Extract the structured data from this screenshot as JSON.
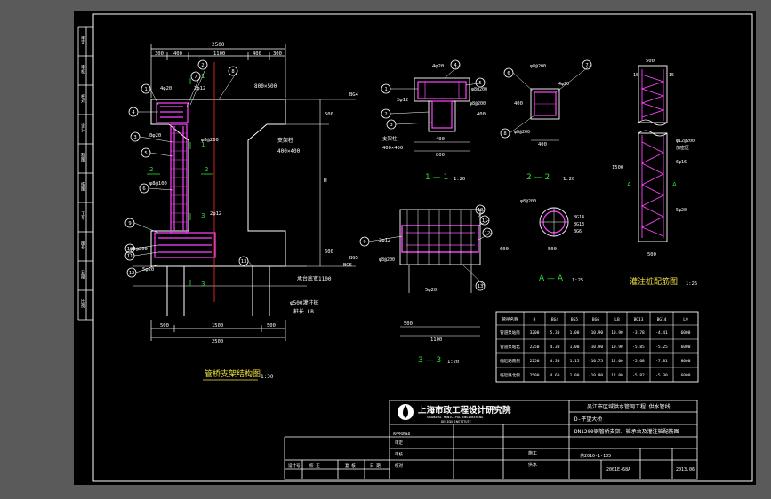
{
  "side_strip": [
    "审定",
    "审核",
    "校对",
    "设计",
    "制图",
    "描图",
    "工号",
    "图号",
    "日期",
    "比例"
  ],
  "main_view": {
    "title": "管桥支架结构图",
    "scale": "1:30",
    "dims_top": [
      "2500",
      "300",
      "400",
      "1100",
      "400",
      "300"
    ],
    "dims_bottom": [
      "500",
      "1500",
      "500",
      "2500"
    ],
    "beam_label": "800×500",
    "pier_label": "支架柱",
    "pier_size": "400×400",
    "pile_label": "承台底宽1100",
    "pile_note_1": "φ500灌注桩",
    "pile_note_2": "桩长 LB",
    "elev_bg4": "BG4",
    "elev_bg5": "BG5",
    "elev_bg6": "BG6",
    "h_label": "H",
    "dim_500": "500",
    "dim_600": "600",
    "rebar_4d20": "4φ20",
    "rebar_2d12": "2φ12",
    "rebar_8d20": "8φ20",
    "rebar_5d20": "5φ20",
    "rebar_s8": "φ8@200",
    "rebar_s8b": "φ8@200",
    "rebar_s8c": "φ8@100",
    "rebar_2d12b": "2φ12",
    "rebar_8d20b": "8φ20",
    "section_marks": [
      "1",
      "1",
      "2",
      "2",
      "3",
      "3"
    ],
    "balloons": [
      "1",
      "2",
      "3",
      "4",
      "5",
      "6",
      "7",
      "8",
      "9",
      "10",
      "11",
      "12",
      "13"
    ]
  },
  "section_1": {
    "title": "1 — 1",
    "scale": "1:20",
    "rebar_top": "4φ20",
    "rebar_side": "2φ12",
    "rebar_stir": "φ8@200",
    "rebar_stir2": "φ8@200",
    "label_pier": "支架柱",
    "pier_size": "400×400",
    "dims": [
      "400",
      "800",
      "400"
    ],
    "balloons": [
      "1",
      "2",
      "3",
      "4",
      "5"
    ]
  },
  "section_2": {
    "title": "2 — 2",
    "scale": "1:20",
    "rebar": [
      "φ8@200",
      "4φ20",
      "φ8@200"
    ],
    "dims": [
      "400",
      "400"
    ],
    "balloons": [
      "6",
      "7",
      "8"
    ]
  },
  "section_3": {
    "title": "3 — 3",
    "scale": "1:20",
    "rebar": [
      "2φ12",
      "φ8@200",
      "5φ20"
    ],
    "dims": [
      "500",
      "1100",
      "600"
    ],
    "balloons": [
      "9",
      "10",
      "11",
      "12",
      "13"
    ]
  },
  "section_a": {
    "title": "A — A",
    "scale": "1:25",
    "rebar": "φ8@200",
    "labels": [
      "BG14",
      "BG13",
      "BG6"
    ],
    "dims": [
      "500"
    ]
  },
  "pile_view": {
    "title": "灌注桩配筋图",
    "scale": "1:25",
    "dims": [
      "500",
      "15",
      "15",
      "1500",
      "500"
    ],
    "label_a": "A",
    "rebar": [
      "φ12@200",
      "加密区",
      "6φ16",
      "5φ20"
    ]
  },
  "table": {
    "headers": [
      "管径名称",
      "H",
      "BG4",
      "BG5",
      "BG6",
      "LB",
      "BG13",
      "BG14",
      "L9"
    ],
    "rows": [
      [
        "管道泵站南",
        "3200",
        "5.30",
        "1.00",
        "-10.90",
        "10.90",
        "-3.78",
        "-4.41",
        "6000"
      ],
      [
        "管道泵站北",
        "2250",
        "4.30",
        "1.00",
        "-10.90",
        "10.90",
        "-5.85",
        "-5.25",
        "6000"
      ],
      [
        "临近路南侧",
        "2250",
        "4.30",
        "1.15",
        "-10.75",
        "12.00",
        "-5.68",
        "-7.81",
        "8000"
      ],
      [
        "临近路北侧",
        "2500",
        "4.60",
        "1.00",
        "-10.90",
        "12.00",
        "-5.82",
        "-5.30",
        "6000"
      ]
    ]
  },
  "title_block": {
    "institute": "上海市政工程设计研究院",
    "institute_en": "SHANGHAI MUNICIPAL ENGINEERING",
    "institute_en2": "DESIGN INSTITUTE",
    "project": "吴江市区域供水管网工程   供水管线",
    "sub": "D-平望大桥",
    "drawing": "DN1200钢管桥支架、桩承台及灌注桩配筋图",
    "approve": "APPROVED",
    "work_no": "供2010-1-105",
    "drawing_no": "2001E-68A",
    "date": "2013.06",
    "row_labels": [
      "审定",
      "审核",
      "校对",
      "设计",
      "制图"
    ],
    "bottom_labels": [
      "设计号",
      "校 正",
      "复 核",
      "日 期"
    ],
    "stage": "施工",
    "sheet": "供水"
  }
}
